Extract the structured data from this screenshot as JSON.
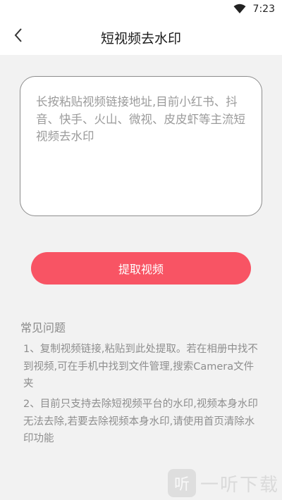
{
  "status_bar": {
    "time": "7:23",
    "icons": [
      "wifi-icon"
    ]
  },
  "header": {
    "back_icon": "chevron-left-icon",
    "title": "短视频去水印"
  },
  "input": {
    "placeholder": "长按粘贴视频链接地址,目前小红书、抖音、快手、火山、微视、皮皮虾等主流短视频去水印",
    "value": ""
  },
  "extract_button": {
    "label": "提取视频"
  },
  "faq": {
    "title": "常见问题",
    "items": [
      "1、复制视频链接,粘贴到此处提取。若在相册中找不到视频,可在手机中找到文件管理,搜索Camera文件夹",
      "2、目前只支持去除短视频平台的水印,视频本身水印无法去除,若要去除视频本身水印,请使用首页清除水印功能"
    ]
  },
  "watermark": {
    "logo_text": "听",
    "text": "一听下载"
  },
  "colors": {
    "accent": "#f85464",
    "background": "#f2f2f2"
  }
}
